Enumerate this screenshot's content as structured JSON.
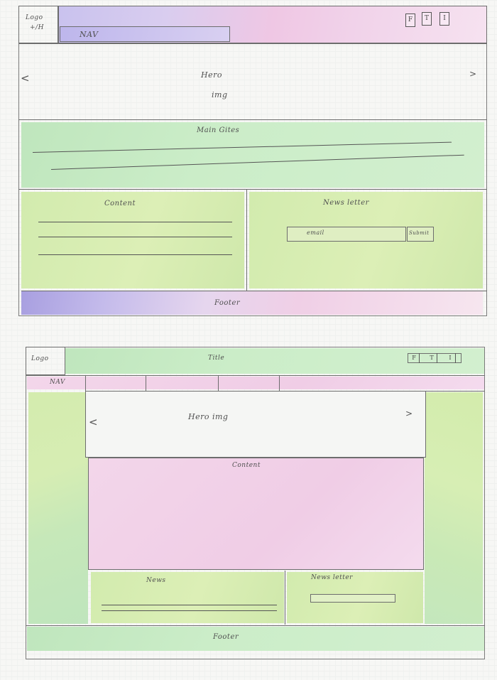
{
  "wireframe_1": {
    "logo": "Logo",
    "logo_sub": "+/H",
    "nav": "NAV",
    "social": [
      "F",
      "T",
      "I"
    ],
    "hero": "Hero",
    "hero_sub": "img",
    "main": "Main Gites",
    "content": "Content",
    "newsletter": "News letter",
    "email_placeholder": "email",
    "submit": "Submit",
    "footer": "Footer",
    "prev": "<",
    "next": ">"
  },
  "wireframe_2": {
    "logo": "Logo",
    "title": "Title",
    "social": [
      "F",
      "T",
      "I"
    ],
    "nav": "NAV",
    "hero": "Hero img",
    "content": "Content",
    "news": "News",
    "newsletter": "News letter",
    "footer": "Footer",
    "prev": "<",
    "next": ">"
  },
  "colors": {
    "pencil": "#6d6d6d",
    "green": "#c8ecc4",
    "yellow_green": "#d6edb0",
    "pink": "#f2d3e8",
    "purple": "#b3a8e6"
  }
}
